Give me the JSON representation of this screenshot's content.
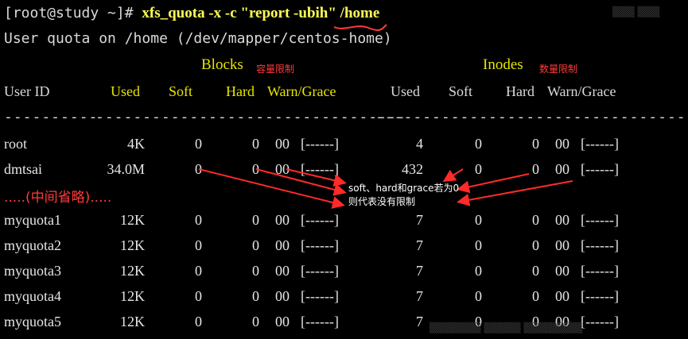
{
  "terminal": {
    "prompt": "[root@study ~]# ",
    "command": "xfs_quota -x -c \"report -ubih\" /home",
    "subtitle": "User quota on /home (/dev/mapper/centos-home)"
  },
  "groups": {
    "blocks_label": "Blocks",
    "blocks_note": "容量限制",
    "inodes_label": "Inodes",
    "inodes_note": "数量限制"
  },
  "columns": [
    "User ID",
    "Used",
    "Soft",
    "Hard",
    "Warn/Grace",
    "Used",
    "Soft",
    "Hard",
    "Warn/Grace"
  ],
  "separator": {
    "user": "----------",
    "blocks": "---------------------------------",
    "inodes": "---------------------------------"
  },
  "rows": [
    {
      "user": "root",
      "b_used": "4K",
      "b_soft": "0",
      "b_hard": "0",
      "b_warn": "00",
      "b_grace": "[------]",
      "i_used": "4",
      "i_soft": "0",
      "i_hard": "0",
      "i_warn": "00",
      "i_grace": "[------]"
    },
    {
      "user": "dmtsai",
      "b_used": "34.0M",
      "b_soft": "0",
      "b_hard": "0",
      "b_warn": "00",
      "b_grace": "[------]",
      "i_used": "432",
      "i_soft": "0",
      "i_hard": "0",
      "i_warn": "00",
      "i_grace": "[------]"
    },
    {
      "user": "myquota1",
      "b_used": "12K",
      "b_soft": "0",
      "b_hard": "0",
      "b_warn": "00",
      "b_grace": "[------]",
      "i_used": "7",
      "i_soft": "0",
      "i_hard": "0",
      "i_warn": "00",
      "i_grace": "[------]"
    },
    {
      "user": "myquota2",
      "b_used": "12K",
      "b_soft": "0",
      "b_hard": "0",
      "b_warn": "00",
      "b_grace": "[------]",
      "i_used": "7",
      "i_soft": "0",
      "i_hard": "0",
      "i_warn": "00",
      "i_grace": "[------]"
    },
    {
      "user": "myquota3",
      "b_used": "12K",
      "b_soft": "0",
      "b_hard": "0",
      "b_warn": "00",
      "b_grace": "[------]",
      "i_used": "7",
      "i_soft": "0",
      "i_hard": "0",
      "i_warn": "00",
      "i_grace": "[------]"
    },
    {
      "user": "myquota4",
      "b_used": "12K",
      "b_soft": "0",
      "b_hard": "0",
      "b_warn": "00",
      "b_grace": "[------]",
      "i_used": "7",
      "i_soft": "0",
      "i_hard": "0",
      "i_warn": "00",
      "i_grace": "[------]"
    },
    {
      "user": "myquota5",
      "b_used": "12K",
      "b_soft": "0",
      "b_hard": "0",
      "b_warn": "00",
      "b_grace": "[------]",
      "i_used": "7",
      "i_soft": "0",
      "i_hard": "0",
      "i_warn": "00",
      "i_grace": "[------]"
    }
  ],
  "omitted": ".....(中间省略).....",
  "callout": {
    "line1": "soft、hard和grace若为0",
    "line2": "则代表没有限制"
  },
  "colors": {
    "background": "#000000",
    "text": "#d9d9d9",
    "command": "#ffff55",
    "header_yellow": "#e5e500",
    "annotation_red": "#ff3b3b"
  }
}
